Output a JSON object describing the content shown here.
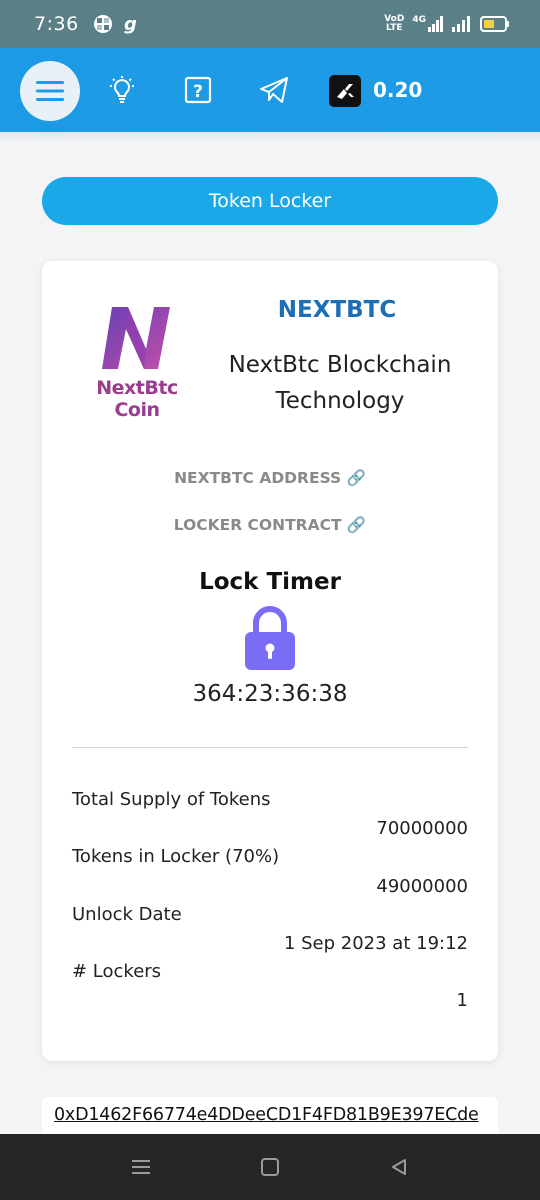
{
  "status_bar": {
    "time": "7:36",
    "left_icons": [
      "pinwheel-icon",
      "g-app-icon"
    ],
    "network_label_top": "VoD",
    "network_label_bottom": "LTE",
    "network_type": "4G",
    "battery_color": "#f4d03f"
  },
  "app_bar": {
    "background": "#1e9be6",
    "icons": [
      "menu-icon",
      "lightbulb-icon",
      "help-icon",
      "telegram-icon",
      "token-logo-icon"
    ],
    "price": "0.20"
  },
  "locker_button": {
    "label": "Token Locker"
  },
  "token": {
    "logo_text": "NextBtc Coin",
    "symbol": "NEXTBTC",
    "name": "NextBtc Blockchain Technology",
    "address_link": "NEXTBTC ADDRESS 🔗",
    "contract_link": "LOCKER CONTRACT 🔗"
  },
  "lock": {
    "title": "Lock Timer",
    "icon": "padlock-icon",
    "icon_color": "#7b6cf6",
    "timer": "364:23:36:38"
  },
  "stats": [
    {
      "label": "Total Supply of Tokens",
      "value": "70000000"
    },
    {
      "label": "Tokens in Locker (70%)",
      "value": "49000000"
    },
    {
      "label": "Unlock Date",
      "value": "1 Sep 2023 at 19:12"
    },
    {
      "label": "# Lockers",
      "value": "1"
    }
  ],
  "locker_address": "0xD1462F66774e4DDeeCD1F4FD81B9E397ECde",
  "nav_bar": {
    "icons": [
      "recent-apps-icon",
      "home-icon",
      "back-icon"
    ]
  }
}
